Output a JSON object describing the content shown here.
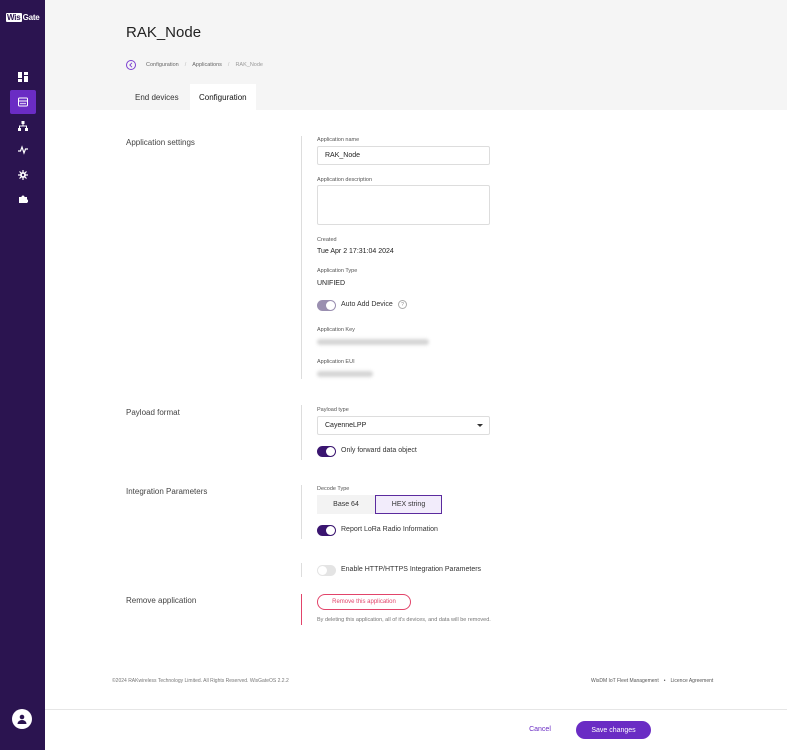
{
  "brand": {
    "logo_box": "Wis",
    "logo_text": "Gate"
  },
  "sidebar": {
    "items": [
      {
        "icon": "dashboard-icon"
      },
      {
        "icon": "gateway-icon"
      },
      {
        "icon": "network-icon"
      },
      {
        "icon": "activity-icon"
      },
      {
        "icon": "settings-icon"
      },
      {
        "icon": "extensions-icon"
      }
    ],
    "active_index": 1
  },
  "header": {
    "title": "RAK_Node",
    "breadcrumb": [
      "Configuration",
      "Applications",
      "RAK_Node"
    ],
    "tabs": [
      "End devices",
      "Configuration"
    ],
    "active_tab": "Configuration"
  },
  "app_settings": {
    "section_label": "Application settings",
    "name_label": "Application name",
    "name_value": "RAK_Node",
    "description_label": "Application description",
    "description_value": "",
    "created_label": "Created",
    "created_value": "Tue Apr 2 17:31:04 2024",
    "type_label": "Application Type",
    "type_value": "UNIFIED",
    "auto_add_label": "Auto Add Device",
    "auto_add_help": "?",
    "key_label": "Application Key",
    "eui_label": "Application EUI"
  },
  "payload": {
    "section_label": "Payload format",
    "type_label": "Payload type",
    "type_value": "CayenneLPP",
    "forward_label": "Only forward data object"
  },
  "integration": {
    "section_label": "Integration Parameters",
    "decode_label": "Decode Type",
    "decode_options": [
      "Base 64",
      "HEX string"
    ],
    "decode_selected": "HEX string",
    "report_label": "Report LoRa Radio Information",
    "http_label": "Enable HTTP/HTTPS Integration Parameters"
  },
  "remove": {
    "section_label": "Remove application",
    "button_label": "Remove this application",
    "note": "By deleting this application, all of it's devices, and data will be removed."
  },
  "footer": {
    "copyright": "©2024 RAKwireless Technology Limited. All Rights Reserved. WisGateOS 2.2.2",
    "link_fleet": "WisDM IoT Fleet Management",
    "link_sep": "•",
    "link_licence": "Licence Agreement"
  },
  "actions": {
    "cancel": "Cancel",
    "save": "Save changes"
  },
  "colors": {
    "sidebar": "#2b1450",
    "accent": "#6a2cc4",
    "danger": "#e2446a"
  }
}
